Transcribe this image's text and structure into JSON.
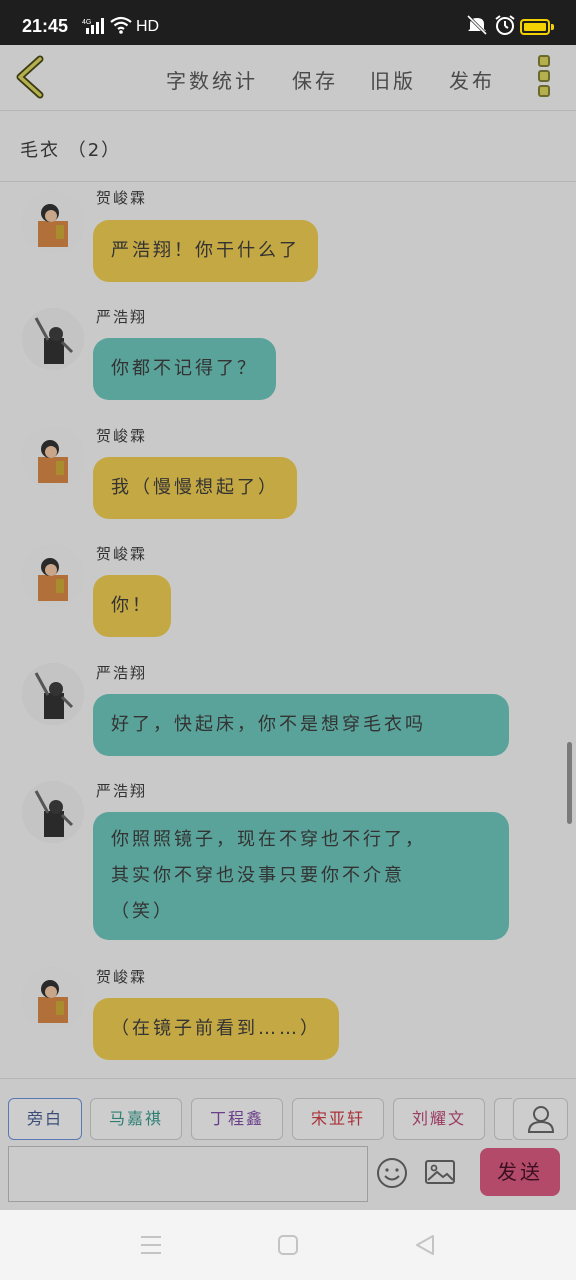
{
  "status": {
    "time": "21:45",
    "hd": "HD"
  },
  "header": {
    "actions": [
      "字数统计",
      "保存",
      "旧版",
      "发布"
    ]
  },
  "conversation_title": "毛衣 （2）",
  "messages": [
    {
      "name": "贺峻霖",
      "text": "严浩翔！你干什么了",
      "color": "yellow"
    },
    {
      "name": "严浩翔",
      "text": "你都不记得了？",
      "color": "teal"
    },
    {
      "name": "贺峻霖",
      "text": "我（慢慢想起了）",
      "color": "yellow"
    },
    {
      "name": "贺峻霖",
      "text": "你！",
      "color": "yellow"
    },
    {
      "name": "严浩翔",
      "text": "好了，快起床，你不是想穿毛衣吗",
      "color": "teal"
    },
    {
      "name": "严浩翔",
      "lines": [
        "你照照镜子，现在不穿也不行了，",
        "其实你不穿也没事只要你不介意",
        "（笑）"
      ],
      "color": "teal"
    },
    {
      "name": "贺峻霖",
      "text": "（在镜子前看到……）",
      "color": "yellow"
    }
  ],
  "roles": [
    {
      "label": "旁白",
      "color": "#3b4e7a"
    },
    {
      "label": "马嘉祺",
      "color": "#2e7f74"
    },
    {
      "label": "丁程鑫",
      "color": "#6a3e8a"
    },
    {
      "label": "宋亚轩",
      "color": "#a8343a"
    },
    {
      "label": "刘耀文",
      "color": "#9a3b62"
    }
  ],
  "composer": {
    "send_label": "发送",
    "placeholder": ""
  },
  "colors": {
    "yellow": "#c4a844",
    "teal": "#5aa39a",
    "send": "#b44a6a"
  }
}
